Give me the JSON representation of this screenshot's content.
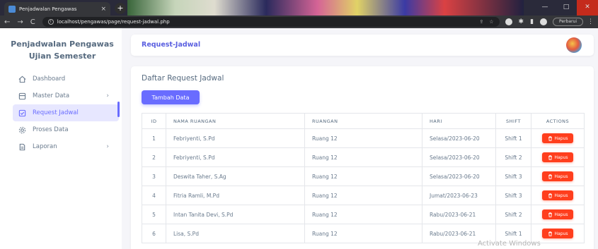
{
  "browser": {
    "tab_title": "Penjadwalan Pengawas",
    "tab_close": "×",
    "new_tab": "+",
    "url": "localhost/pengawas/page/request-jadwal.php",
    "pause_label": "Perbarui",
    "back": "←",
    "forward": "→",
    "reload": "C",
    "kebab": "⋮",
    "win_min": "—",
    "win_max": "□",
    "win_close": "✕"
  },
  "sidebar": {
    "brand": "Penjadwalan Pengawas Ujian Semester",
    "items": [
      {
        "label": "Dashboard",
        "icon": "home-icon",
        "has_chevron": false
      },
      {
        "label": "Master Data",
        "icon": "database-icon",
        "has_chevron": true
      },
      {
        "label": "Request Jadwal",
        "icon": "checkbox-icon",
        "has_chevron": false,
        "active": true
      },
      {
        "label": "Proses Data",
        "icon": "gear-icon",
        "has_chevron": false
      },
      {
        "label": "Laporan",
        "icon": "report-icon",
        "has_chevron": true
      }
    ],
    "chevron": "›"
  },
  "topbar": {
    "title": "Request-Jadwal"
  },
  "main": {
    "heading": "Daftar Request Jadwal",
    "add_button": "Tambah Data",
    "columns": [
      "ID",
      "NAMA RUANGAN",
      "RUANGAN",
      "HARI",
      "SHIFT",
      "ACTIONS"
    ],
    "delete_label": "Hapus",
    "rows": [
      {
        "id": "1",
        "nama": "Febriyenti, S.Pd",
        "ruangan": "Ruang 12",
        "hari": "Selasa/2023-06-20",
        "shift": "Shift 1"
      },
      {
        "id": "2",
        "nama": "Febriyenti, S.Pd",
        "ruangan": "Ruang 12",
        "hari": "Selasa/2023-06-20",
        "shift": "Shift 2"
      },
      {
        "id": "3",
        "nama": "Deswita Taher, S.Ag",
        "ruangan": "Ruang 12",
        "hari": "Selasa/2023-06-20",
        "shift": "Shift 3"
      },
      {
        "id": "4",
        "nama": "Fitria Ramli, M.Pd",
        "ruangan": "Ruang 12",
        "hari": "Jumat/2023-06-23",
        "shift": "Shift 3"
      },
      {
        "id": "5",
        "nama": "Intan Tanita Devi, S.Pd",
        "ruangan": "Ruang 12",
        "hari": "Rabu/2023-06-21",
        "shift": "Shift 2"
      },
      {
        "id": "6",
        "nama": "Lisa, S.Pd",
        "ruangan": "Ruang 12",
        "hari": "Rabu/2023-06-21",
        "shift": "Shift 1"
      }
    ]
  },
  "watermark": "Activate Windows",
  "colors": {
    "primary": "#696cff",
    "danger": "#ff3e1d",
    "text": "#697a8d"
  }
}
